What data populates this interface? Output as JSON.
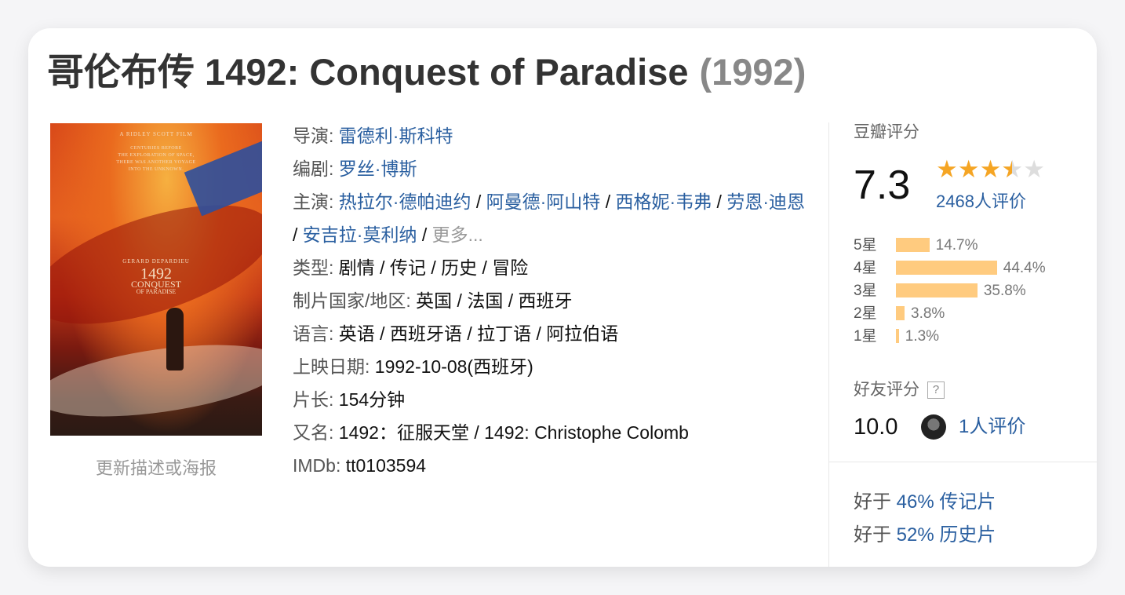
{
  "title": {
    "name": "哥伦布传 1492: Conquest of Paradise",
    "year": "(1992)"
  },
  "poster": {
    "credit": "A RIDLEY SCOTT FILM",
    "tagline": [
      "CENTURIES BEFORE",
      "THE EXPLORATION OF SPACE,",
      "THERE WAS ANOTHER VOYAGE",
      "INTO THE UNKNOWN."
    ],
    "actor": "GERARD DEPARDIEU",
    "title_line1": "1492",
    "title_line2": "CONQUEST",
    "title_line3": "OF PARADISE",
    "update_link": "更新描述或海报"
  },
  "info": {
    "director_label": "导演:",
    "director": "雷德利·斯科特",
    "writer_label": "编剧:",
    "writer": "罗丝·博斯",
    "cast_label": "主演:",
    "cast": [
      "热拉尔·德帕迪约",
      "阿曼德·阿山特",
      "西格妮·韦弗",
      "劳恩·迪恩",
      "安吉拉·莫利纳"
    ],
    "cast_sep": "/",
    "cast_more": "更多...",
    "genre_label": "类型:",
    "genre_value": "剧情 / 传记 / 历史 / 冒险",
    "country_label": "制片国家/地区:",
    "country_value": "英国 / 法国 / 西班牙",
    "language_label": "语言:",
    "language_value": "英语 / 西班牙语 / 拉丁语 / 阿拉伯语",
    "release_label": "上映日期:",
    "release_value": "1992-10-08(西班牙)",
    "runtime_label": "片长:",
    "runtime_value": "154分钟",
    "aka_label": "又名:",
    "aka_value": "1492：征服天堂 / 1492: Christophe Colomb",
    "imdb_label": "IMDb:",
    "imdb_value": "tt0103594"
  },
  "rating": {
    "header": "豆瓣评分",
    "score": "7.3",
    "stars": 3.5,
    "star_color": "#f5a524",
    "votes": "2468人评价",
    "bar_color": "#ffcb7f",
    "distribution": [
      {
        "label": "5星",
        "percent": 14.7,
        "text": "14.7%"
      },
      {
        "label": "4星",
        "percent": 44.4,
        "text": "44.4%"
      },
      {
        "label": "3星",
        "percent": 35.8,
        "text": "35.8%"
      },
      {
        "label": "2星",
        "percent": 3.8,
        "text": "3.8%"
      },
      {
        "label": "1星",
        "percent": 1.3,
        "text": "1.3%"
      }
    ]
  },
  "friends": {
    "header": "好友评分",
    "help": "?",
    "score": "10.0",
    "votes": "1人评价"
  },
  "better_than": [
    {
      "prefix": "好于",
      "value": "46% 传记片"
    },
    {
      "prefix": "好于",
      "value": "52% 历史片"
    }
  ]
}
